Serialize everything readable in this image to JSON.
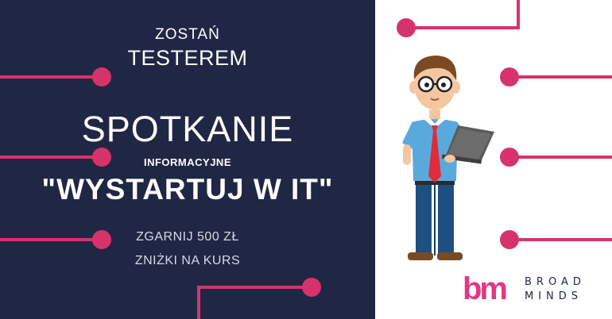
{
  "headline": {
    "line1": "ZOSTAŃ",
    "line2": "TESTEREM",
    "title": "SPOTKANIE",
    "subtitle": "INFORMACYJNE",
    "event_name": "\"WYSTARTUJ W IT\"",
    "offer_line1": "ZGARNIJ 500 ZŁ",
    "offer_line2": "ZNIŻKI NA KURS"
  },
  "logo": {
    "mark": "bm",
    "word1": "BROAD",
    "word2": "MINDS"
  },
  "colors": {
    "navy": "#1f2744",
    "accent": "#d6336c",
    "white": "#ffffff"
  },
  "illustration": "man-with-laptop-icon"
}
